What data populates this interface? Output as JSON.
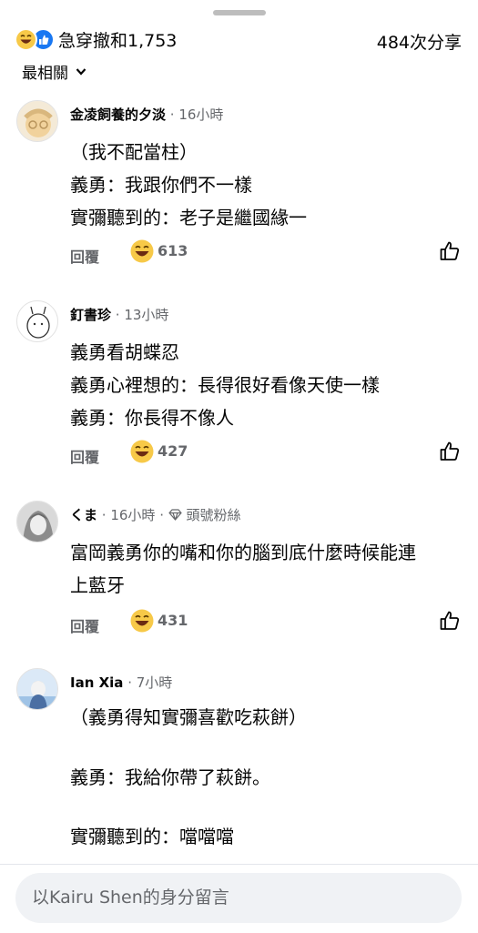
{
  "header": {
    "reaction_count": "急穿撤和1,753",
    "shares": "484次分享",
    "sort_label": "最相關"
  },
  "comments": [
    {
      "author": "金凌飼養的夕淡",
      "time": "· 16小時",
      "lines": [
        "（我不配當柱）",
        "義勇：我跟你們不一樣",
        "實彌聽到的：老子是繼國緣一"
      ],
      "reply": "回覆",
      "reactions": "613"
    },
    {
      "author": "釘書珍",
      "time": "· 13小時",
      "lines": [
        "義勇看胡蝶忍",
        "義勇心裡想的：長得很好看像天使一樣",
        "義勇：你長得不像人"
      ],
      "reply": "回覆",
      "reactions": "427"
    },
    {
      "author": "くま",
      "time": "· 16小時 ·",
      "badge": "頭號粉絲",
      "lines": [
        "富岡義勇你的嘴和你的腦到底什麼時候能連",
        "上藍牙"
      ],
      "reply": "回覆",
      "reactions": "431"
    },
    {
      "author": "Ian Xia",
      "time": "· 7小時",
      "lines": [
        "（義勇得知實彌喜歡吃萩餅）",
        "義勇：我給你帶了萩餅。",
        "實彌聽到的：噹噹噹"
      ]
    }
  ],
  "composer": {
    "placeholder": "以Kairu Shen的身分留言"
  },
  "colors": {
    "like_blue": "#1877f2",
    "haha_yellow": "#f7c948",
    "meta_gray": "#65676b"
  }
}
